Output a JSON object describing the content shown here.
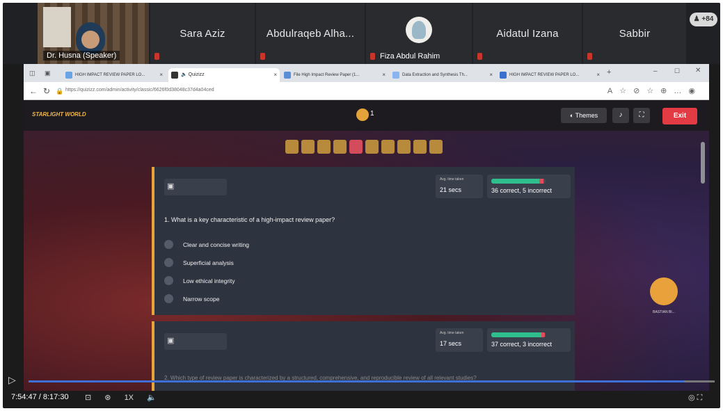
{
  "participants": {
    "speaker": {
      "caption": "Dr. Husna (Speaker)"
    },
    "tiles": [
      {
        "name": "Sara Aziz"
      },
      {
        "name": "Abdulraqeb Alha..."
      },
      {
        "name": "Fiza Abdul Rahim"
      },
      {
        "name": "Aidatul Izana"
      },
      {
        "name": "Sabbir"
      }
    ],
    "more_label": "+84"
  },
  "browser": {
    "tabs": [
      {
        "label": "HIGH IMPACT REVIEW PAPER LO..."
      },
      {
        "label": "Quizizz"
      },
      {
        "label": "File High Impact Review Paper (1..."
      },
      {
        "label": "Data Extraction and Synthesis Th..."
      },
      {
        "label": "HIGH IMPACT REVIEW PAPER LO..."
      }
    ],
    "url": "https://quizizz.com/admin/activity/classic/6626f0d38048c37d4a04ced"
  },
  "quiz": {
    "logo": "STARLIGHT WORLD",
    "player_count": "1",
    "themes_label": "Themes",
    "exit_label": "Exit",
    "question_pills": 10,
    "current_pill": 4,
    "questions": [
      {
        "avg_label": "Avg. time taken",
        "avg_value": "21 secs",
        "result_text": "36 correct, 5 incorrect",
        "correct_fraction": 0.88,
        "text": "1. What is a key characteristic of a high-impact review paper?",
        "options": [
          "Clear and concise writing",
          "Superficial analysis",
          "Low ethical integrity",
          "Narrow scope"
        ]
      },
      {
        "avg_label": "Avg. time taken",
        "avg_value": "17 secs",
        "result_text": "37 correct, 3 incorrect",
        "correct_fraction": 0.925,
        "text": "2. Which type of review paper is characterized by a structured, comprehensive, and reproducible review of all relevant studies?"
      }
    ],
    "side_character_name": "BASTIAN BI..."
  },
  "player": {
    "time": "7:54:47 / 8:17:30",
    "speed": "1X"
  }
}
